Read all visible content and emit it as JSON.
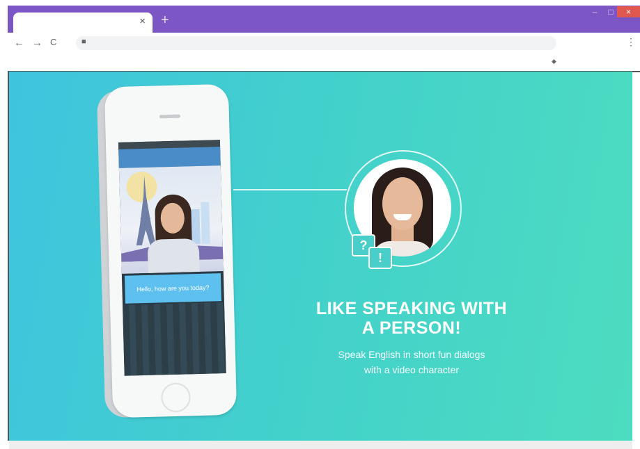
{
  "browser": {
    "tab_close": "×",
    "new_tab": "+",
    "window": {
      "minimize": "–",
      "maximize": "□",
      "close": "×"
    },
    "nav": {
      "back": "←",
      "forward": "→",
      "reload": "C"
    },
    "lock_icon": "lock-icon",
    "menu": "⋮",
    "extension_icon": "extension-icon"
  },
  "phone": {
    "dialog_bubble": "Hello, how are you today?"
  },
  "promo": {
    "question_mark": "?",
    "exclamation_mark": "!",
    "headline_line1": "LIKE SPEAKING WITH",
    "headline_line2": "A PERSON!",
    "subtitle_line1": "Speak English in short fun dialogs",
    "subtitle_line2": "with a video character"
  },
  "colors": {
    "titlebar": "#7b56c4",
    "content_start": "#3fc4df",
    "content_end": "#4ddcc0",
    "close_button": "#e0584f"
  }
}
